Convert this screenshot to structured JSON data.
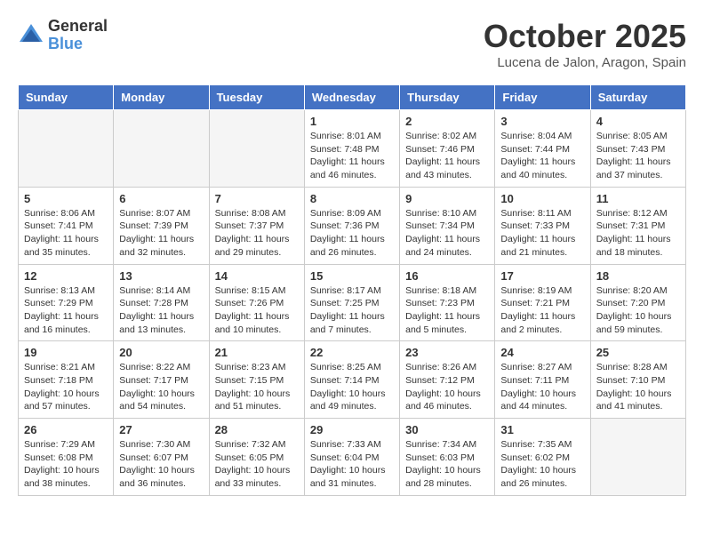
{
  "header": {
    "logo_general": "General",
    "logo_blue": "Blue",
    "month_title": "October 2025",
    "location": "Lucena de Jalon, Aragon, Spain"
  },
  "days_of_week": [
    "Sunday",
    "Monday",
    "Tuesday",
    "Wednesday",
    "Thursday",
    "Friday",
    "Saturday"
  ],
  "weeks": [
    [
      {
        "num": "",
        "info": ""
      },
      {
        "num": "",
        "info": ""
      },
      {
        "num": "",
        "info": ""
      },
      {
        "num": "1",
        "info": "Sunrise: 8:01 AM\nSunset: 7:48 PM\nDaylight: 11 hours and 46 minutes."
      },
      {
        "num": "2",
        "info": "Sunrise: 8:02 AM\nSunset: 7:46 PM\nDaylight: 11 hours and 43 minutes."
      },
      {
        "num": "3",
        "info": "Sunrise: 8:04 AM\nSunset: 7:44 PM\nDaylight: 11 hours and 40 minutes."
      },
      {
        "num": "4",
        "info": "Sunrise: 8:05 AM\nSunset: 7:43 PM\nDaylight: 11 hours and 37 minutes."
      }
    ],
    [
      {
        "num": "5",
        "info": "Sunrise: 8:06 AM\nSunset: 7:41 PM\nDaylight: 11 hours and 35 minutes."
      },
      {
        "num": "6",
        "info": "Sunrise: 8:07 AM\nSunset: 7:39 PM\nDaylight: 11 hours and 32 minutes."
      },
      {
        "num": "7",
        "info": "Sunrise: 8:08 AM\nSunset: 7:37 PM\nDaylight: 11 hours and 29 minutes."
      },
      {
        "num": "8",
        "info": "Sunrise: 8:09 AM\nSunset: 7:36 PM\nDaylight: 11 hours and 26 minutes."
      },
      {
        "num": "9",
        "info": "Sunrise: 8:10 AM\nSunset: 7:34 PM\nDaylight: 11 hours and 24 minutes."
      },
      {
        "num": "10",
        "info": "Sunrise: 8:11 AM\nSunset: 7:33 PM\nDaylight: 11 hours and 21 minutes."
      },
      {
        "num": "11",
        "info": "Sunrise: 8:12 AM\nSunset: 7:31 PM\nDaylight: 11 hours and 18 minutes."
      }
    ],
    [
      {
        "num": "12",
        "info": "Sunrise: 8:13 AM\nSunset: 7:29 PM\nDaylight: 11 hours and 16 minutes."
      },
      {
        "num": "13",
        "info": "Sunrise: 8:14 AM\nSunset: 7:28 PM\nDaylight: 11 hours and 13 minutes."
      },
      {
        "num": "14",
        "info": "Sunrise: 8:15 AM\nSunset: 7:26 PM\nDaylight: 11 hours and 10 minutes."
      },
      {
        "num": "15",
        "info": "Sunrise: 8:17 AM\nSunset: 7:25 PM\nDaylight: 11 hours and 7 minutes."
      },
      {
        "num": "16",
        "info": "Sunrise: 8:18 AM\nSunset: 7:23 PM\nDaylight: 11 hours and 5 minutes."
      },
      {
        "num": "17",
        "info": "Sunrise: 8:19 AM\nSunset: 7:21 PM\nDaylight: 11 hours and 2 minutes."
      },
      {
        "num": "18",
        "info": "Sunrise: 8:20 AM\nSunset: 7:20 PM\nDaylight: 10 hours and 59 minutes."
      }
    ],
    [
      {
        "num": "19",
        "info": "Sunrise: 8:21 AM\nSunset: 7:18 PM\nDaylight: 10 hours and 57 minutes."
      },
      {
        "num": "20",
        "info": "Sunrise: 8:22 AM\nSunset: 7:17 PM\nDaylight: 10 hours and 54 minutes."
      },
      {
        "num": "21",
        "info": "Sunrise: 8:23 AM\nSunset: 7:15 PM\nDaylight: 10 hours and 51 minutes."
      },
      {
        "num": "22",
        "info": "Sunrise: 8:25 AM\nSunset: 7:14 PM\nDaylight: 10 hours and 49 minutes."
      },
      {
        "num": "23",
        "info": "Sunrise: 8:26 AM\nSunset: 7:12 PM\nDaylight: 10 hours and 46 minutes."
      },
      {
        "num": "24",
        "info": "Sunrise: 8:27 AM\nSunset: 7:11 PM\nDaylight: 10 hours and 44 minutes."
      },
      {
        "num": "25",
        "info": "Sunrise: 8:28 AM\nSunset: 7:10 PM\nDaylight: 10 hours and 41 minutes."
      }
    ],
    [
      {
        "num": "26",
        "info": "Sunrise: 7:29 AM\nSunset: 6:08 PM\nDaylight: 10 hours and 38 minutes."
      },
      {
        "num": "27",
        "info": "Sunrise: 7:30 AM\nSunset: 6:07 PM\nDaylight: 10 hours and 36 minutes."
      },
      {
        "num": "28",
        "info": "Sunrise: 7:32 AM\nSunset: 6:05 PM\nDaylight: 10 hours and 33 minutes."
      },
      {
        "num": "29",
        "info": "Sunrise: 7:33 AM\nSunset: 6:04 PM\nDaylight: 10 hours and 31 minutes."
      },
      {
        "num": "30",
        "info": "Sunrise: 7:34 AM\nSunset: 6:03 PM\nDaylight: 10 hours and 28 minutes."
      },
      {
        "num": "31",
        "info": "Sunrise: 7:35 AM\nSunset: 6:02 PM\nDaylight: 10 hours and 26 minutes."
      },
      {
        "num": "",
        "info": ""
      }
    ]
  ]
}
